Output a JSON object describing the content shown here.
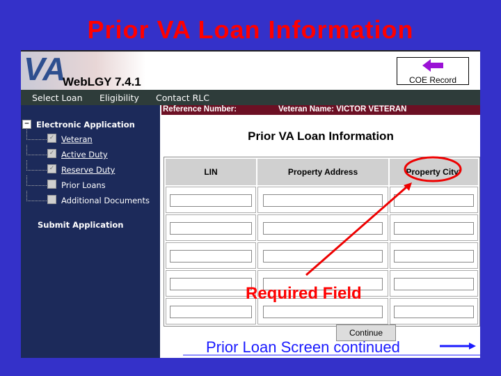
{
  "slide_title": "Prior VA Loan Information",
  "app": {
    "logo": "VA",
    "version": "WebLGY 7.4.1",
    "coe_record": "COE Record"
  },
  "nav": [
    "Select Loan",
    "Eligibility",
    "Contact RLC"
  ],
  "sidebar": {
    "section": "Electronic Application",
    "items": [
      {
        "label": "Veteran",
        "checked": true,
        "link": true
      },
      {
        "label": "Active Duty",
        "checked": true,
        "link": true
      },
      {
        "label": "Reserve Duty",
        "checked": true,
        "link": true
      },
      {
        "label": "Prior Loans",
        "checked": false,
        "link": false
      },
      {
        "label": "Additional Documents",
        "checked": false,
        "link": false
      }
    ],
    "submit": "Submit Application"
  },
  "ref_label": "Reference Number:",
  "veteran_name": "Veteran Name: VICTOR VETERAN",
  "page_heading": "Prior VA Loan Information",
  "table": {
    "columns": [
      "LIN",
      "Property Address",
      "Property City*"
    ],
    "rows": 5
  },
  "continue": "Continue",
  "annotation": "Required Field",
  "caption": "Prior Loan Screen continued",
  "colors": {
    "background": "#3431c9",
    "title": "#ff0000",
    "annotation": "#ff0000",
    "sidebar": "#1c2a5a",
    "refbar": "#6c1024"
  }
}
